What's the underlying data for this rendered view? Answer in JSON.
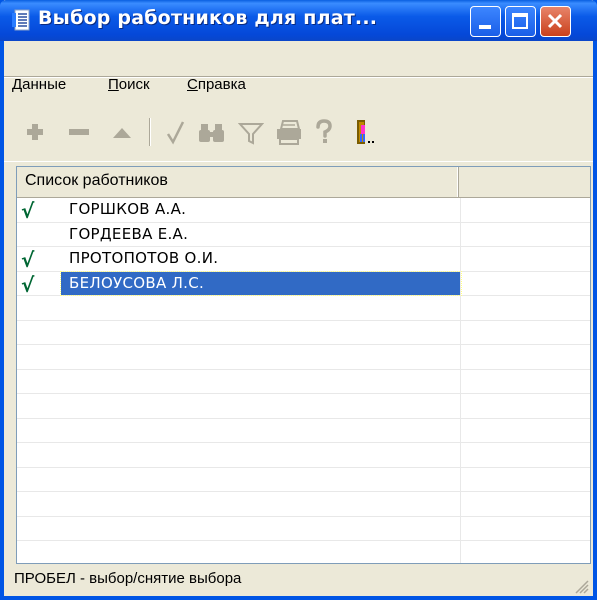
{
  "window": {
    "title": "Выбор работников для плат...",
    "accent": "#0055e5",
    "buttons": [
      "minimize-button",
      "maximize-button",
      "close-button"
    ]
  },
  "menu": {
    "items": [
      {
        "label_u": "Д",
        "label_rest": "анные"
      },
      {
        "label_u": "П",
        "label_rest": "оиск"
      },
      {
        "label_u": "С",
        "label_rest": "правка"
      }
    ]
  },
  "toolbar": {
    "icons": [
      "add-icon",
      "remove-icon",
      "up-icon",
      "check-icon",
      "binoculars-icon",
      "filter-icon",
      "print-icon",
      "help-icon",
      "exit-icon"
    ]
  },
  "list": {
    "column_header": "Список работников",
    "rows": [
      {
        "checked": true,
        "name": "ГОРШКОВ А.А."
      },
      {
        "checked": false,
        "name": "ГОРДЕЕВА Е.А."
      },
      {
        "checked": true,
        "name": "ПРОТОПОТОВ О.И."
      },
      {
        "checked": true,
        "name": "БЕЛОУСОВА Л.С.",
        "selected": true
      }
    ],
    "selection_color": "#316ac5",
    "check_glyph": "√"
  },
  "status": {
    "text": "ПРОБЕЛ - выбор/снятие выбора"
  }
}
